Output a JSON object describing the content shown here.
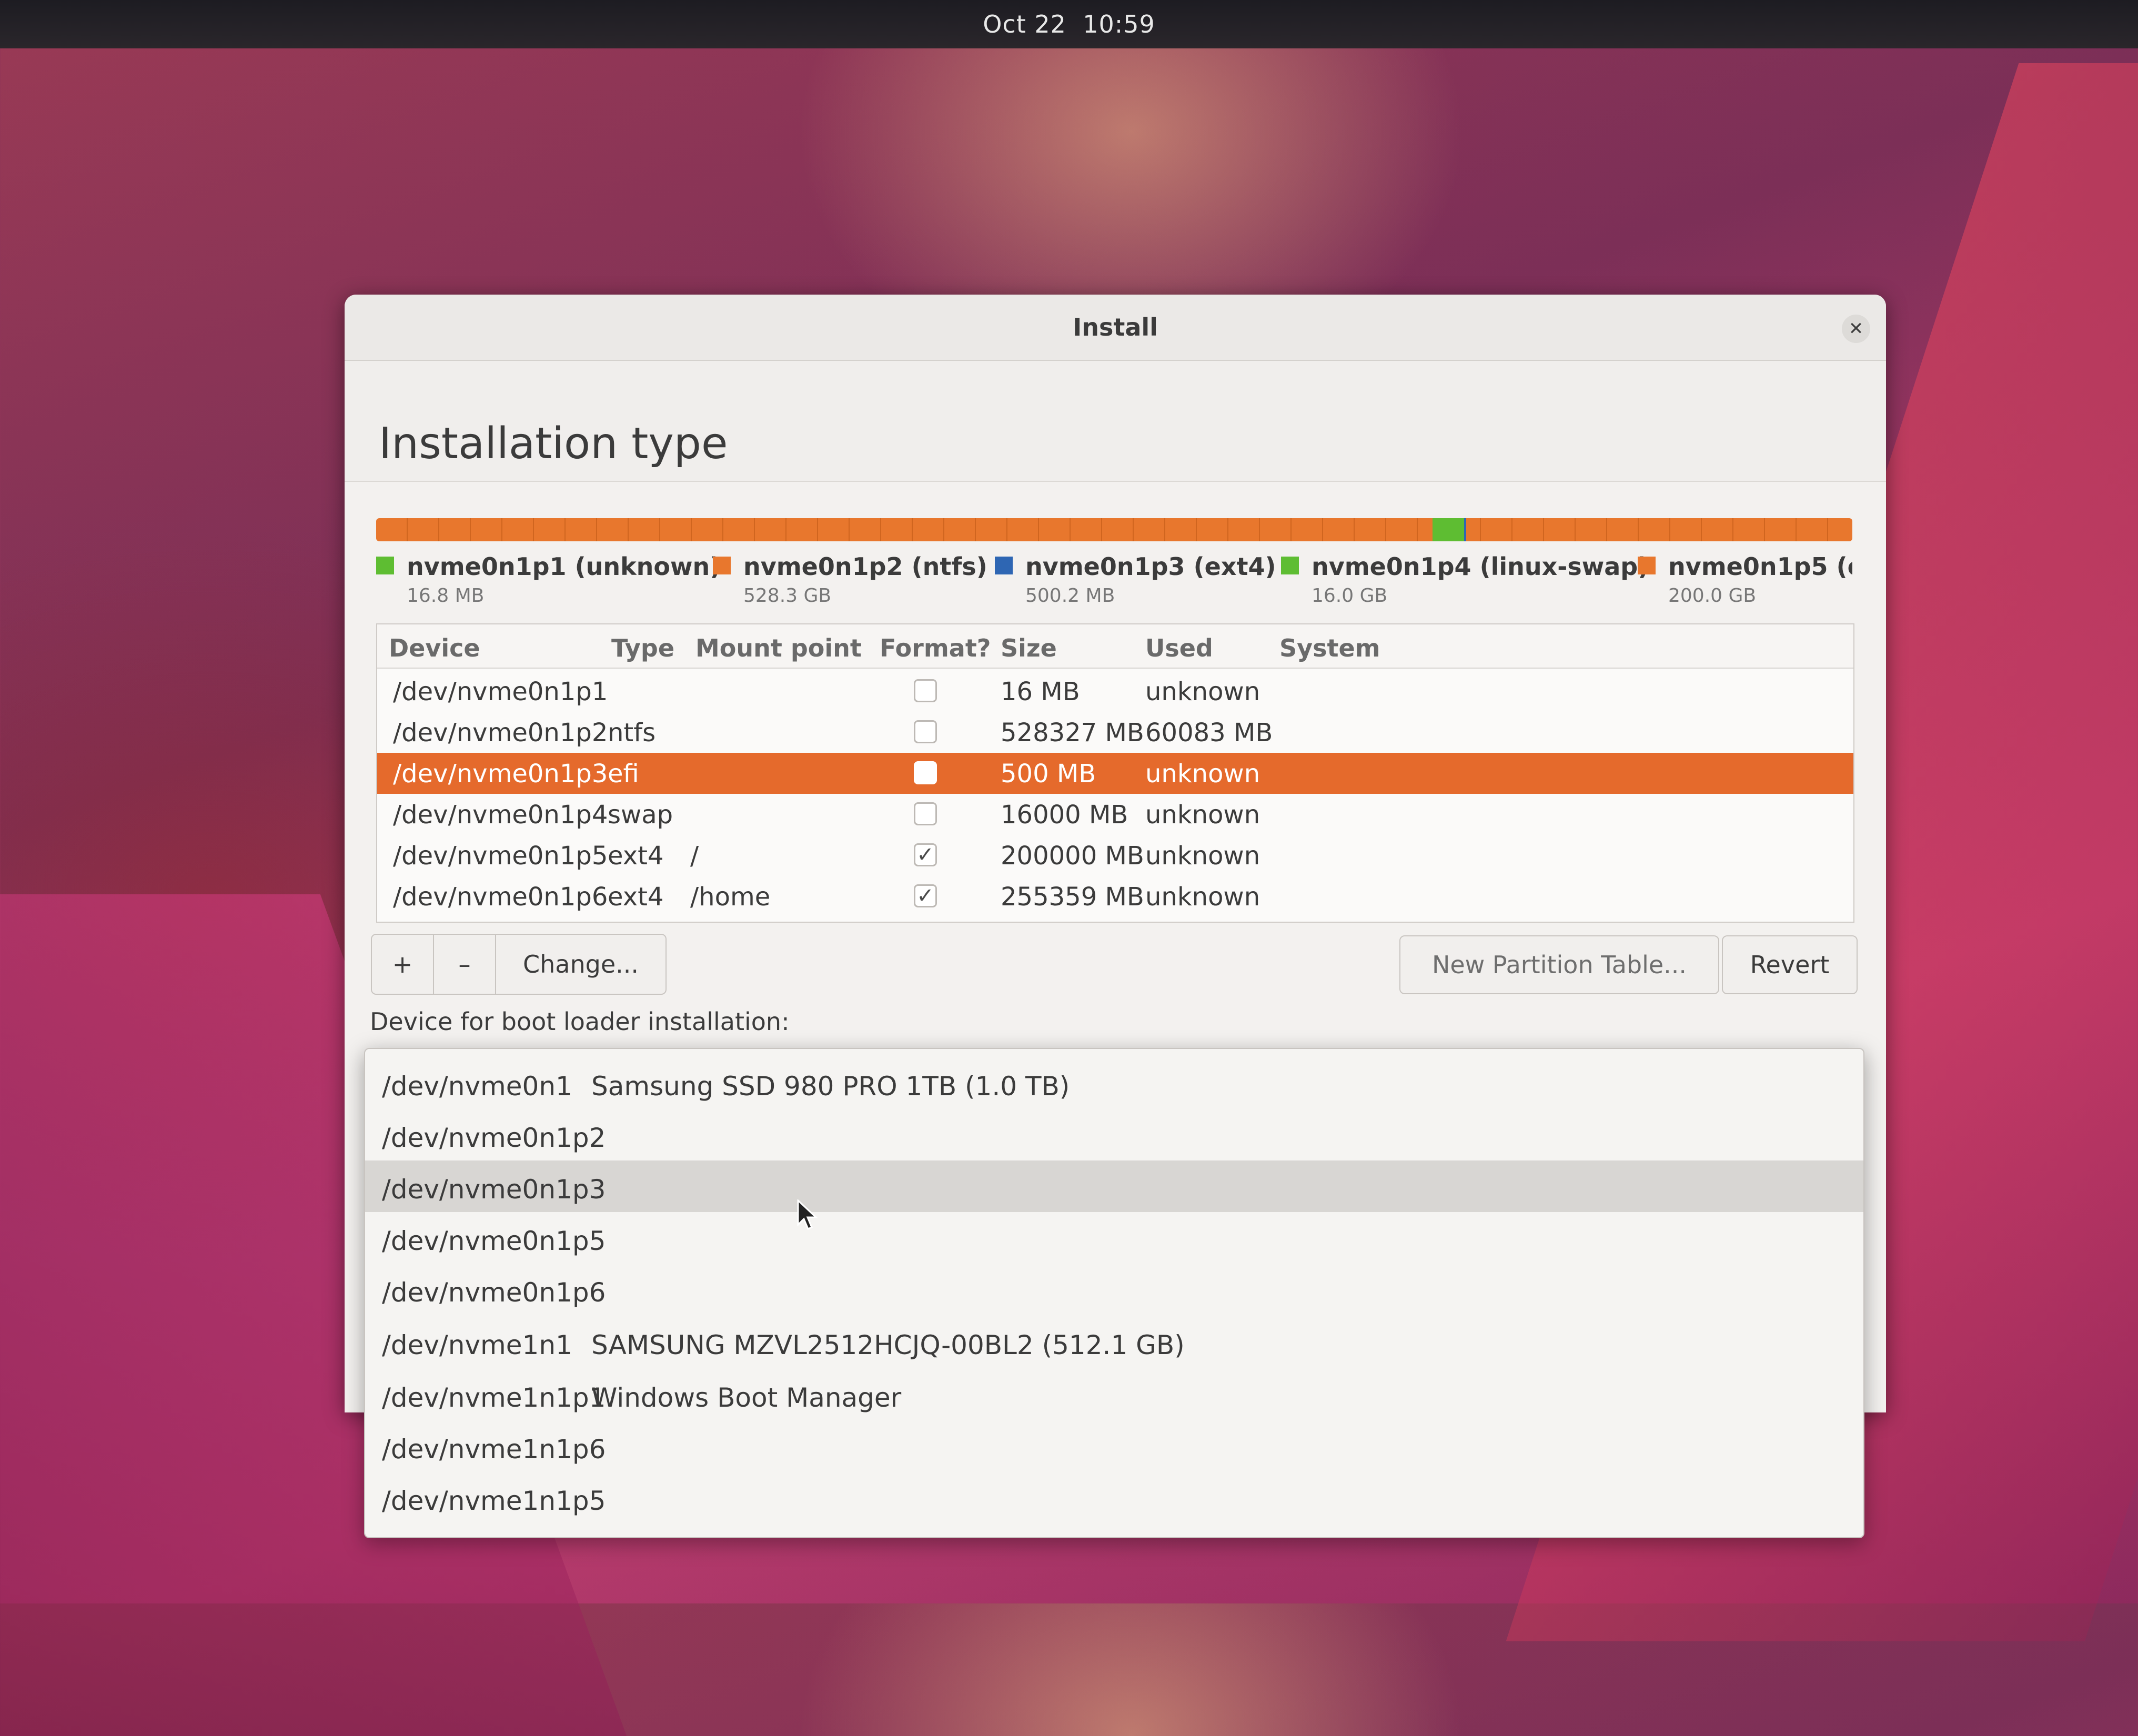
{
  "topbar": {
    "date": "Oct 22",
    "time": "10:59"
  },
  "window": {
    "title": "Install",
    "close_icon": "close-icon"
  },
  "page": {
    "title": "Installation type"
  },
  "partition_bar": {
    "colors": {
      "orange": "#e8772d",
      "green": "#5ebd32",
      "blue": "#2e66b3"
    }
  },
  "legend": [
    {
      "label": "nvme0n1p1 (unknown)",
      "size": "16.8 MB",
      "color": "#5ebd32"
    },
    {
      "label": "nvme0n1p2 (ntfs)",
      "size": "528.3 GB",
      "color": "#e8772d"
    },
    {
      "label": "nvme0n1p3 (ext4)",
      "size": "500.2 MB",
      "color": "#2e66b3"
    },
    {
      "label": "nvme0n1p4 (linux-swap)",
      "size": "16.0 GB",
      "color": "#5ebd32"
    },
    {
      "label": "nvme0n1p5 (e",
      "size": "200.0 GB",
      "color": "#e8772d"
    }
  ],
  "table": {
    "headers": {
      "device": "Device",
      "type": "Type",
      "mount": "Mount point",
      "format": "Format?",
      "size": "Size",
      "used": "Used",
      "system": "System"
    },
    "rows": [
      {
        "device": "/dev/nvme0n1p1",
        "type": "",
        "mount": "",
        "format": "",
        "size": "16 MB",
        "used": "unknown",
        "system": ""
      },
      {
        "device": "/dev/nvme0n1p2",
        "type": "ntfs",
        "mount": "",
        "format": "",
        "size": "528327 MB",
        "used": "60083 MB",
        "system": ""
      },
      {
        "device": "/dev/nvme0n1p3",
        "type": "efi",
        "mount": "",
        "format": "",
        "size": "500 MB",
        "used": "unknown",
        "system": ""
      },
      {
        "device": "/dev/nvme0n1p4",
        "type": "swap",
        "mount": "",
        "format": "",
        "size": "16000 MB",
        "used": "unknown",
        "system": ""
      },
      {
        "device": "/dev/nvme0n1p5",
        "type": "ext4",
        "mount": "/",
        "format": "✓",
        "size": "200000 MB",
        "used": "unknown",
        "system": ""
      },
      {
        "device": "/dev/nvme0n1p6",
        "type": "ext4",
        "mount": "/home",
        "format": "✓",
        "size": "255359 MB",
        "used": "unknown",
        "system": ""
      }
    ],
    "selected_color": "#e56a2c"
  },
  "toolbar": {
    "add_label": "+",
    "remove_label": "–",
    "change_label": "Change...",
    "new_table_label": "New Partition Table...",
    "revert_label": "Revert"
  },
  "boot_loader": {
    "label": "Device for boot loader installation:",
    "options": [
      {
        "device": "/dev/nvme0n1",
        "desc": "Samsung SSD 980 PRO 1TB (1.0 TB)"
      },
      {
        "device": "/dev/nvme0n1p2",
        "desc": ""
      },
      {
        "device": "/dev/nvme0n1p3",
        "desc": ""
      },
      {
        "device": "/dev/nvme0n1p5",
        "desc": ""
      },
      {
        "device": "/dev/nvme0n1p6",
        "desc": ""
      },
      {
        "device": "/dev/nvme1n1",
        "desc": "SAMSUNG MZVL2512HCJQ-00BL2 (512.1 GB)"
      },
      {
        "device": "/dev/nvme1n1p1",
        "desc": "Windows Boot Manager"
      },
      {
        "device": "/dev/nvme1n1p6",
        "desc": ""
      },
      {
        "device": "/dev/nvme1n1p5",
        "desc": ""
      }
    ]
  }
}
